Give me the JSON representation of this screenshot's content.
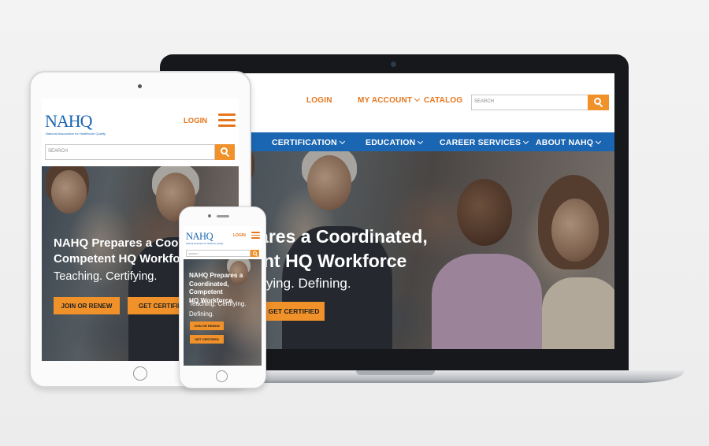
{
  "laptop": {
    "header": {
      "login": "LOGIN",
      "my_account": "MY ACCOUNT",
      "catalog": "CATALOG",
      "search_placeholder": "SEARCH"
    },
    "nav": [
      "CERTIFICATION",
      "EDUCATION",
      "CAREER SERVICES",
      "ABOUT NAHQ"
    ],
    "hero": {
      "title_line1": "pares a Coordinated,",
      "title_line2": "nt HQ Workforce",
      "subtitle": "rtifying. Defining.",
      "cta": "GET CERTIFIED"
    }
  },
  "tablet": {
    "logo": "NAHQ",
    "tagline": "National Association for Healthcare Quality",
    "login": "LOGIN",
    "search_placeholder": "SEARCH",
    "hero": {
      "title_line1": "NAHQ Prepares a Coord",
      "title_line2": "Competent HQ Workforc",
      "subtitle": "Teaching. Certifying.",
      "cta_join": "JOIN OR RENEW",
      "cta_certified": "GET CERTIFIE"
    }
  },
  "phone": {
    "logo": "NAHQ",
    "tagline": "National Association for Healthcare Quality",
    "login": "LOGIN",
    "search_placeholder": "SEARCH",
    "hero": {
      "title_line1": "NAHQ Prepares a",
      "title_line2": "Coordinated, Competent",
      "title_line3": "HQ Workforce",
      "subtitle_line1": "Teaching. Certifying.",
      "subtitle_line2": "Defining.",
      "cta_join": "JOIN OR RENEW",
      "cta_certified": "GET CERTIFIED"
    }
  },
  "colors": {
    "brand_blue": "#1b66b2",
    "accent_orange": "#f0912a",
    "link_orange": "#e6761d"
  }
}
